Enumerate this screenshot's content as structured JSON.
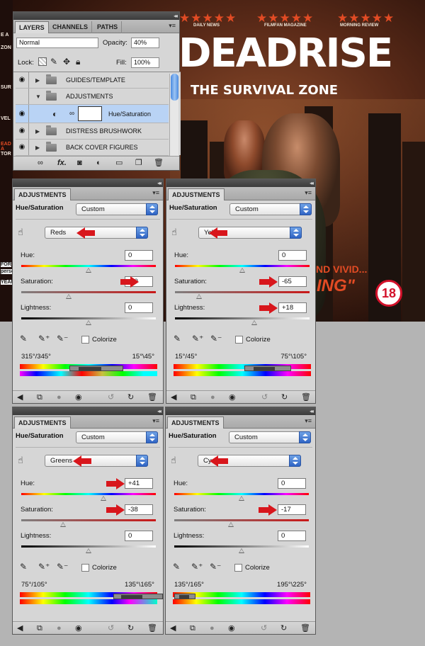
{
  "poster": {
    "reviews": [
      {
        "stars": "★★★★★",
        "source": "DAILY NEWS"
      },
      {
        "stars": "★★★★★",
        "source": "FILMFAN MAGAZINE"
      },
      {
        "stars": "★★★★★",
        "source": "MORNING REVIEW"
      }
    ],
    "title": "DEADRISE",
    "subtitle": "THE SURVIVAL ZONE",
    "tagline_1": "ND VIVID...",
    "tagline_2": "ING\"",
    "rating": "18",
    "left_strip_texts": [
      "E A",
      "ZON",
      "SUR",
      "VEL",
      "EAD A",
      "TOR",
      "FOR",
      "perso",
      "YEAR"
    ]
  },
  "layers_panel": {
    "tabs": [
      "LAYERS",
      "CHANNELS",
      "PATHS"
    ],
    "blend_mode": "Normal",
    "opacity_label": "Opacity:",
    "opacity_value": "40%",
    "lock_label": "Lock:",
    "fill_label": "Fill:",
    "fill_value": "100%",
    "layers": [
      {
        "name": "GUIDES/TEMPLATE"
      },
      {
        "name": "ADJUSTMENTS"
      },
      {
        "name": "Hue/Saturation"
      },
      {
        "name": "DISTRESS BRUSHWORK"
      },
      {
        "name": "BACK COVER FIGURES"
      }
    ],
    "footer_fx": "fx."
  },
  "adjustments": [
    {
      "tab": "ADJUSTMENTS",
      "title": "Hue/Saturation",
      "preset": "Custom",
      "channel": "Reds",
      "hue_label": "Hue:",
      "hue": "0",
      "sat_label": "Saturation:",
      "saturation": "-30",
      "light_label": "Lightness:",
      "lightness": "0",
      "colorize": "Colorize",
      "range_left": "315°/345°",
      "range_right": "15°\\45°",
      "hue_pos": 0.5,
      "sat_pos": 0.35,
      "light_pos": 0.5
    },
    {
      "tab": "ADJUSTMENTS",
      "title": "Hue/Saturation",
      "preset": "Custom",
      "channel": "Yellows",
      "hue_label": "Hue:",
      "hue": "0",
      "sat_label": "Saturation:",
      "saturation": "-65",
      "light_label": "Lightness:",
      "lightness": "+18",
      "colorize": "Colorize",
      "range_left": "15°/45°",
      "range_right": "75°\\105°",
      "hue_pos": 0.5,
      "sat_pos": 0.18,
      "light_pos": 0.59
    },
    {
      "tab": "ADJUSTMENTS",
      "title": "Hue/Saturation",
      "preset": "Custom",
      "channel": "Greens",
      "hue_label": "Hue:",
      "hue": "+41",
      "sat_label": "Saturation:",
      "saturation": "-38",
      "light_label": "Lightness:",
      "lightness": "0",
      "colorize": "Colorize",
      "range_left": "75°/105°",
      "range_right": "135°\\165°",
      "hue_pos": 0.61,
      "sat_pos": 0.31,
      "light_pos": 0.5
    },
    {
      "tab": "ADJUSTMENTS",
      "title": "Hue/Saturation",
      "preset": "Custom",
      "channel": "Cyans",
      "hue_label": "Hue:",
      "hue": "0",
      "sat_label": "Saturation:",
      "saturation": "-17",
      "light_label": "Lightness:",
      "lightness": "0",
      "colorize": "Colorize",
      "range_left": "135°/165°",
      "range_right": "195°\\225°",
      "hue_pos": 0.5,
      "sat_pos": 0.42,
      "light_pos": 0.5
    }
  ],
  "colors": {
    "accent_arrow": "#d8161c",
    "selection": "#b9d3f5",
    "poster_red": "#e24b24"
  }
}
